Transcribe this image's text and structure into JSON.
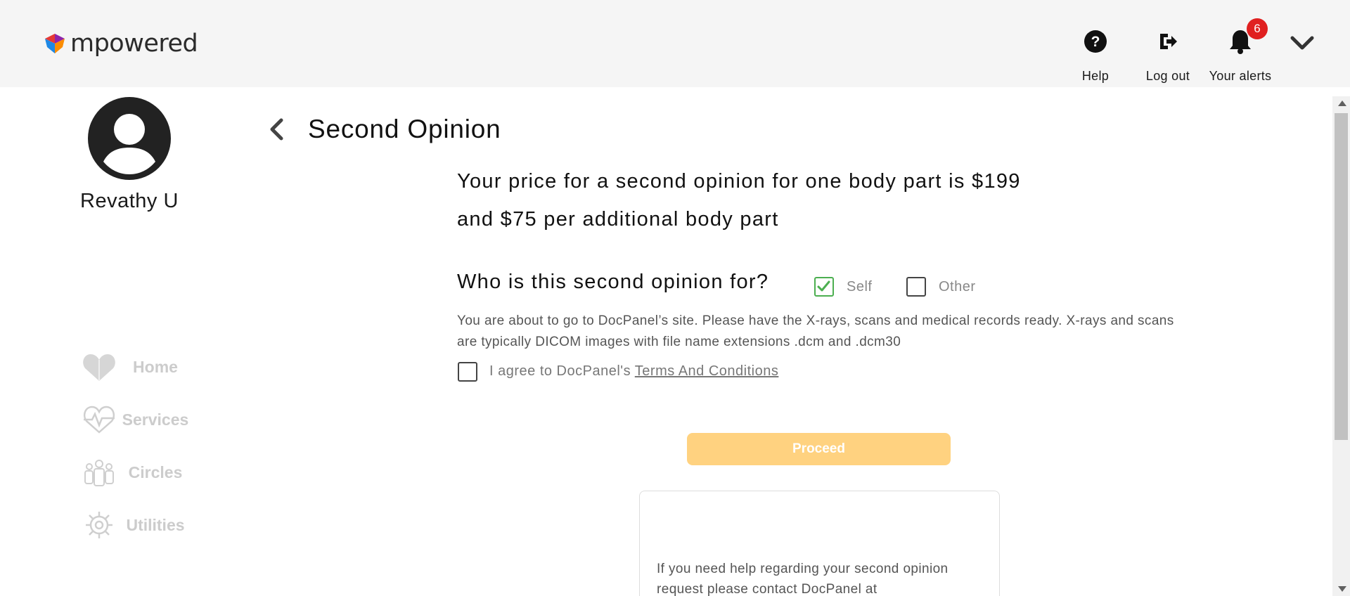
{
  "header": {
    "brand": "mpowered",
    "help_label": "Help",
    "logout_label": "Log out",
    "alerts_label": "Your alerts",
    "alerts_count": "6",
    "brand_colors": [
      "#e53935",
      "#1e88e5",
      "#fb8c00",
      "#8e24aa"
    ]
  },
  "sidebar": {
    "user_name": "Revathy U",
    "nav": [
      {
        "label": "Home",
        "icon": "heart-home-icon"
      },
      {
        "label": "Services",
        "icon": "heartbeat-icon"
      },
      {
        "label": "Circles",
        "icon": "people-icon"
      },
      {
        "label": "Utilities",
        "icon": "gear-icon"
      }
    ]
  },
  "main": {
    "title": "Second Opinion",
    "price_line_1": "Your price for a second opinion for one body part is $199",
    "price_line_2": "and $75 per additional body part",
    "question": "Who is this second opinion for?",
    "option_self": "Self",
    "option_other": "Other",
    "self_checked": true,
    "other_checked": false,
    "info": "You are about to go to DocPanel’s site. Please have the X-rays, scans and medical records ready. X-rays and scans are typically DICOM images with file name extensions .dcm and .dcm30",
    "agree_prefix": "I agree to DocPanel's ",
    "agree_link": "Terms And Conditions",
    "agree_checked": false,
    "proceed_label": "Proceed",
    "help_text": "If you need help regarding your second opinion request please contact DocPanel at"
  },
  "colors": {
    "accent_button": "#ffd280",
    "check_green": "#4caf50",
    "badge_red": "#e02020",
    "nav_disabled": "#cccccc"
  }
}
